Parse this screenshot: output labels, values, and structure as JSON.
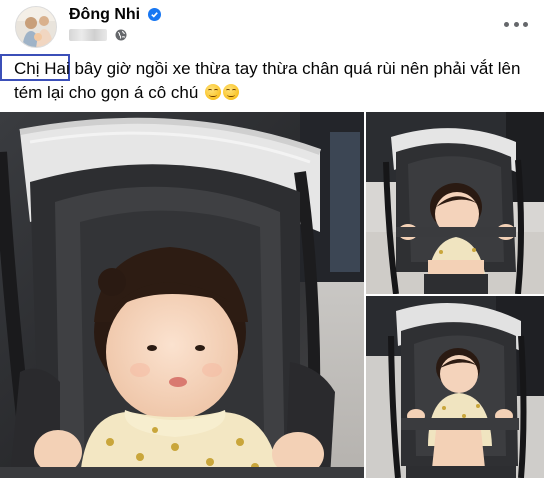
{
  "post": {
    "author": "Đông Nhi",
    "verified": true,
    "privacy_icon": "globe-icon",
    "more_icon": "more-options-icon",
    "text_part1": "Chị Hai",
    "text_part2": " bây giờ ngồi xe thừa tay thừa chân quá rùi nên phải vắt lên tém lại cho gọn á cô chú",
    "emojis": [
      "smiling-face-emoji",
      "smiling-face-emoji"
    ]
  },
  "photos": [
    {
      "name": "baby-stroller-photo-main"
    },
    {
      "name": "baby-stroller-photo-top-right"
    },
    {
      "name": "baby-stroller-photo-bottom-right"
    }
  ],
  "colors": {
    "accent_blue": "#1877f2",
    "highlight_box": "#3b4fb8",
    "secondary_text": "#65676b"
  }
}
